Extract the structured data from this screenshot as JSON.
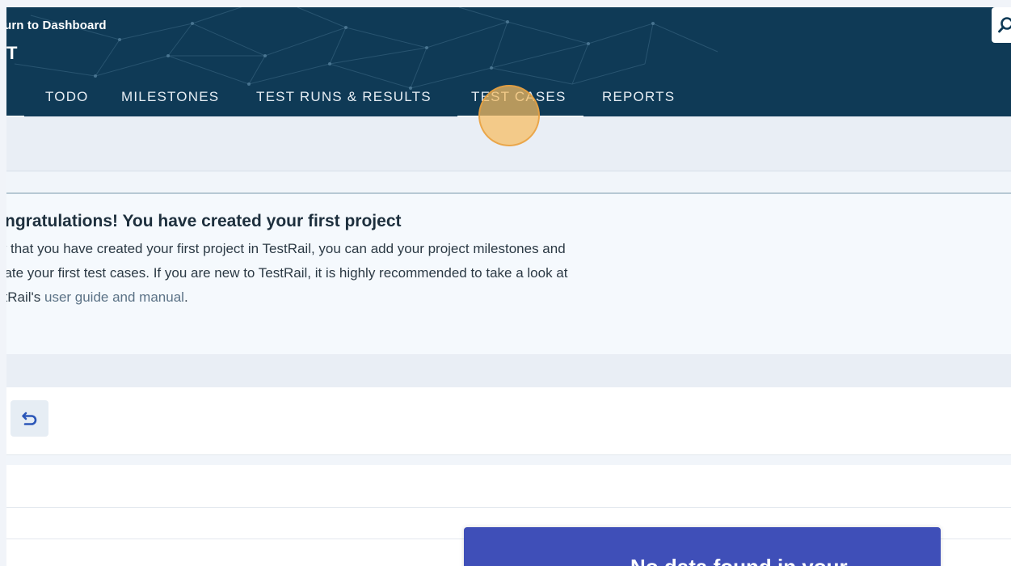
{
  "header": {
    "back_link": "turn to Dashboard",
    "project_title": "T",
    "tabs": [
      {
        "label": "/",
        "active": true
      },
      {
        "label": "TODO"
      },
      {
        "label": "MILESTONES"
      },
      {
        "label": "TEST RUNS & RESULTS"
      },
      {
        "label": "TEST CASES",
        "active": true
      },
      {
        "label": "REPORTS"
      }
    ],
    "search_icon": "search-icon"
  },
  "notice": {
    "title": "ngratulations! You have created your first project",
    "line1": "w that you have created your first project in TestRail, you can add your project milestones and",
    "line2": "eate your first test cases. If you are new to TestRail, it is highly recommended to take a look at",
    "line3_prefix": "stRail's ",
    "link_text": "user guide and manual",
    "line3_suffix": "."
  },
  "toolbar": {
    "undo_icon": "undo-icon"
  },
  "empty_state": {
    "message": "No data found in your"
  },
  "colors": {
    "header_bg": "#0f3a56",
    "accent_blue": "#3f4fb8",
    "click_marker": "#f6bd60"
  }
}
